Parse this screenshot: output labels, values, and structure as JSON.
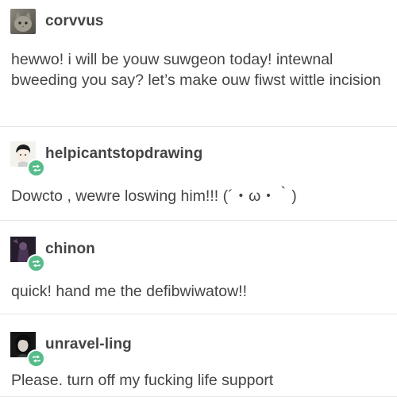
{
  "posts": [
    {
      "username": "corvvus",
      "avatar": "cat-photo-icon",
      "reblogged": false,
      "text": "hewwo! i will be youw suwgeon today! intewnal bweeding you say? let’s make ouw fiwst wittle incision"
    },
    {
      "username": "helpicantstopdrawing",
      "avatar": "drawn-character-icon",
      "reblogged": true,
      "text": "Dowcto , wewre loswing him!!! (´・ω・｀)"
    },
    {
      "username": "chinon",
      "avatar": "dark-figure-icon",
      "reblogged": true,
      "text": "quick! hand me the defibwiwatow!!"
    },
    {
      "username": "unravel-ling",
      "avatar": "dark-portrait-icon",
      "reblogged": true,
      "text": "Please. turn off my fucking life support"
    }
  ],
  "colors": {
    "reblog_badge": "#56bc8a",
    "text": "#444444",
    "divider": "#e6e6e6"
  }
}
